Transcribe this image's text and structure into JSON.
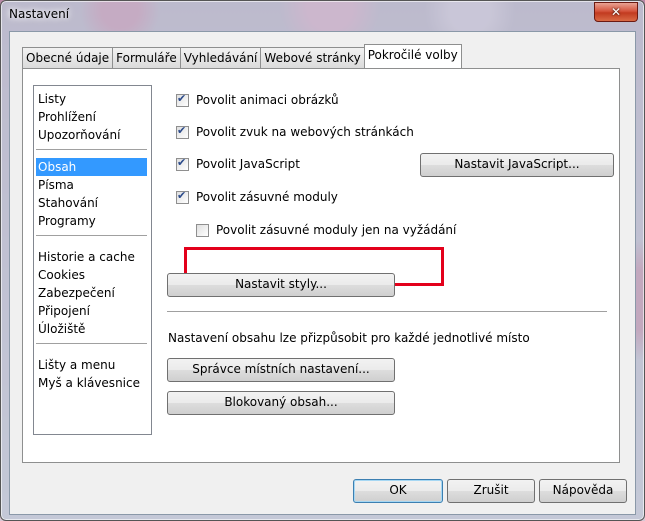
{
  "window": {
    "title": "Nastavení",
    "close": "✕"
  },
  "tabs": [
    {
      "label": "Obecné údaje"
    },
    {
      "label": "Formuláře"
    },
    {
      "label": "Vyhledávání"
    },
    {
      "label": "Webové stránky"
    },
    {
      "label": "Pokročilé volby",
      "active": true
    }
  ],
  "sidebar": {
    "groups": [
      [
        "Listy",
        "Prohlížení",
        "Upozorňování"
      ],
      [
        "Obsah",
        "Písma",
        "Stahování",
        "Programy"
      ],
      [
        "Historie a cache",
        "Cookies",
        "Zabezpečení",
        "Připojení",
        "Úložiště"
      ],
      [
        "Lišty a menu",
        "Myš a klávesnice"
      ]
    ],
    "selected": "Obsah"
  },
  "content": {
    "checkboxes": [
      {
        "label": "Povolit animaci obrázků",
        "checked": true
      },
      {
        "label": "Povolit zvuk na webových stránkách",
        "checked": true
      },
      {
        "label": "Povolit JavaScript",
        "checked": true
      },
      {
        "label": "Povolit zásuvné moduly",
        "checked": true
      },
      {
        "label": "Povolit zásuvné moduly jen na vyžádání",
        "checked": false
      }
    ],
    "js_button": "Nastavit JavaScript...",
    "styles_button": "Nastavit styly...",
    "info_text": "Nastavení obsahu lze přizpůsobit pro každé jednotlivé místo",
    "site_prefs_button": "Správce místních nastavení...",
    "blocked_button": "Blokovaný obsah..."
  },
  "footer": {
    "ok": "OK",
    "cancel": "Zrušit",
    "help": "Nápověda"
  },
  "colors": {
    "selection": "#3399ff",
    "highlight_border": "#e3001b"
  }
}
